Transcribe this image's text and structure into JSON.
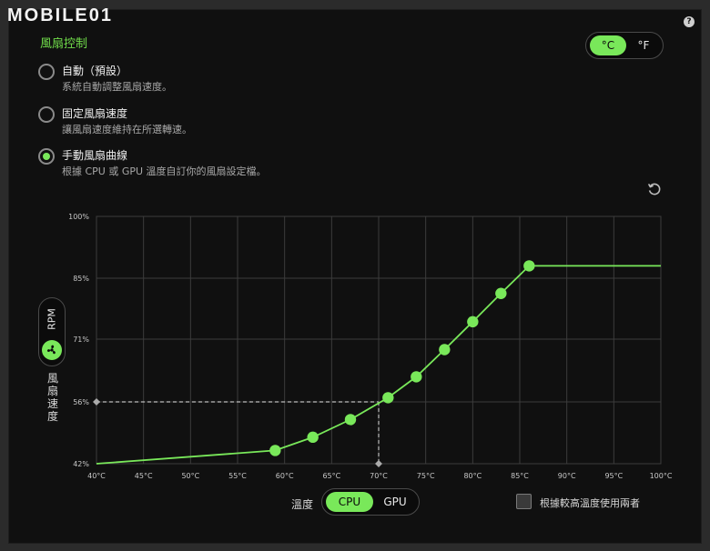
{
  "brand": {
    "logo_text": "MOBILE01"
  },
  "header": {
    "title": "風扇控制",
    "help_icon": "question-icon"
  },
  "units": {
    "celsius": "°C",
    "fahrenheit": "°F",
    "selected": "celsius"
  },
  "modes": [
    {
      "title": "自動（預設）",
      "desc": "系統自動調整風扇速度。",
      "selected": false
    },
    {
      "title": "固定風扇速度",
      "desc": "讓風扇速度維持在所選轉速。",
      "selected": false
    },
    {
      "title": "手動風扇曲線",
      "desc": "根據 CPU 或 GPU 溫度自訂你的風扇設定檔。",
      "selected": true
    }
  ],
  "side": {
    "rpm_label": "RPM",
    "axis_label": "風扇速度",
    "fan_icon": "fan-icon"
  },
  "controls": {
    "reset_icon": "reset-icon",
    "temp_label": "溫度",
    "source_cpu": "CPU",
    "source_gpu": "GPU",
    "source_selected": "CPU",
    "checkbox_label": "根據較高溫度使用兩者",
    "checkbox_checked": false
  },
  "colors": {
    "accent": "#79e85a",
    "grid": "#3c3c3c",
    "background": "#101010"
  },
  "chart_data": {
    "type": "line",
    "x_ticks": [
      "40°C",
      "45°C",
      "50°C",
      "55°C",
      "60°C",
      "65°C",
      "70°C",
      "75°C",
      "80°C",
      "85°C",
      "90°C",
      "95°C",
      "100°C"
    ],
    "y_ticks": [
      "100%",
      "85%",
      "71%",
      "56%",
      "42%"
    ],
    "xlim": [
      40,
      100
    ],
    "ylim": [
      42,
      100
    ],
    "grid": true,
    "series": [
      {
        "points": [
          {
            "x": 40,
            "y": 42
          },
          {
            "x": 59,
            "y": 45
          },
          {
            "x": 63,
            "y": 48
          },
          {
            "x": 67,
            "y": 52
          },
          {
            "x": 71,
            "y": 57
          },
          {
            "x": 74,
            "y": 62
          },
          {
            "x": 77,
            "y": 68.5
          },
          {
            "x": 80,
            "y": 75
          },
          {
            "x": 83,
            "y": 81.5
          },
          {
            "x": 86,
            "y": 88
          },
          {
            "x": 100,
            "y": 88
          }
        ],
        "handles": [
          59,
          63,
          67,
          71,
          74,
          77,
          80,
          83,
          86
        ]
      }
    ],
    "readout": {
      "x": 70,
      "y": 56
    }
  }
}
